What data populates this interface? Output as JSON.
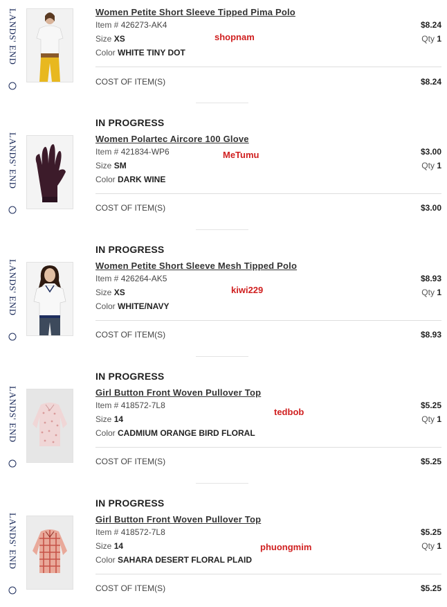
{
  "brand_text": "LANDS' END",
  "labels": {
    "item_prefix": "Item # ",
    "size": "Size ",
    "color": "Color ",
    "qty": "Qty ",
    "cost": "COST OF ITEM(S)"
  },
  "items": [
    {
      "status": "",
      "title": "Women Petite Short Sleeve Tipped Pima Polo",
      "item_no": "426273-AK4",
      "size": "XS",
      "color": "WHITE TINY DOT",
      "price": "$8.24",
      "qty": "1",
      "cost": "$8.24",
      "seller": "shopnam",
      "image": "white-polo-yellow-pants"
    },
    {
      "status": "IN PROGRESS",
      "title": "Women Polartec Aircore 100 Glove",
      "item_no": "421834-WP6",
      "size": "SM",
      "color": "DARK WINE",
      "price": "$3.00",
      "qty": "1",
      "cost": "$3.00",
      "seller": "MeTumu",
      "image": "dark-wine-glove"
    },
    {
      "status": "IN PROGRESS",
      "title": "Women Petite Short Sleeve Mesh Tipped Polo",
      "item_no": "426264-AK5",
      "size": "XS",
      "color": "WHITE/NAVY",
      "price": "$8.93",
      "qty": "1",
      "cost": "$8.93",
      "seller": "kiwi229",
      "image": "white-navy-polo"
    },
    {
      "status": "IN PROGRESS",
      "title": "Girl Button Front Woven Pullover Top",
      "item_no": "418572-7L8",
      "size": "14",
      "color": "CADMIUM ORANGE BIRD FLORAL",
      "price": "$5.25",
      "qty": "1",
      "cost": "$5.25",
      "seller": "tedbob",
      "image": "pink-floral-top"
    },
    {
      "status": "IN PROGRESS",
      "title": "Girl Button Front Woven Pullover Top",
      "item_no": "418572-7L8",
      "size": "14",
      "color": "SAHARA DESERT FLORAL PLAID",
      "price": "$5.25",
      "qty": "1",
      "cost": "$5.25",
      "seller": "phuongmim",
      "image": "red-plaid-top"
    }
  ]
}
